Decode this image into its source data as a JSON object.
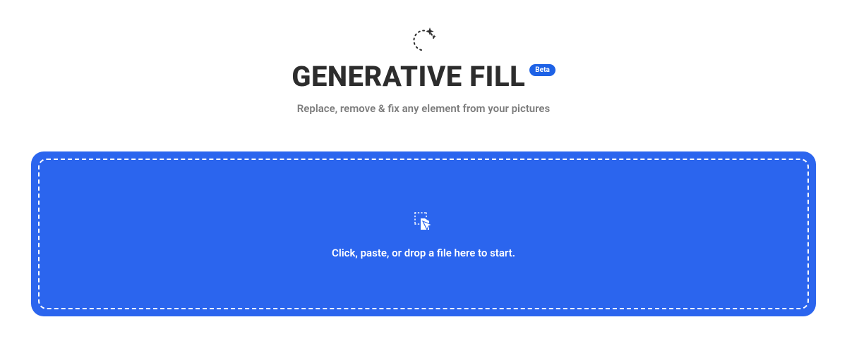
{
  "header": {
    "title": "GENERATIVE FILL",
    "badge": "Beta",
    "subtitle": "Replace, remove & fix any element from your pictures"
  },
  "dropzone": {
    "text": "Click, paste, or drop a file here to start."
  },
  "colors": {
    "accent": "#2b65ee",
    "badge": "#1e62e6",
    "textDark": "#2d2d2d",
    "textMuted": "#7d7d7d"
  }
}
